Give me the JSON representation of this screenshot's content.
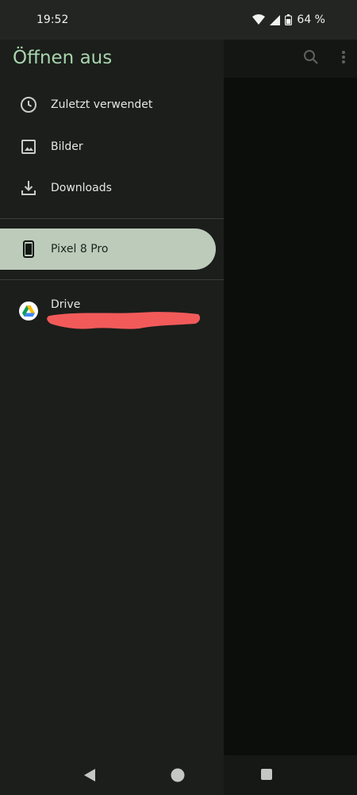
{
  "status_bar": {
    "time": "19:52",
    "battery": "64 %"
  },
  "drawer": {
    "title": "Öffnen aus",
    "items": [
      {
        "label": "Zuletzt verwendet",
        "icon": "clock-icon"
      },
      {
        "label": "Bilder",
        "icon": "image-icon"
      },
      {
        "label": "Downloads",
        "icon": "download-icon"
      }
    ],
    "device": {
      "label": "Pixel 8 Pro",
      "icon": "phone-icon",
      "selected": true
    },
    "cloud": {
      "label": "Drive",
      "icon": "google-drive-icon"
    }
  },
  "app_bar": {
    "icons": [
      "search-icon",
      "more-vert-icon"
    ]
  },
  "nav_bar": {
    "icons": [
      "back-icon",
      "home-icon",
      "recents-icon"
    ]
  },
  "colors": {
    "accent": "#a8d5ad",
    "selected_bg": "#bdcbbb",
    "drawer_bg": "#1b1e1b",
    "redaction": "#f25a5a"
  }
}
